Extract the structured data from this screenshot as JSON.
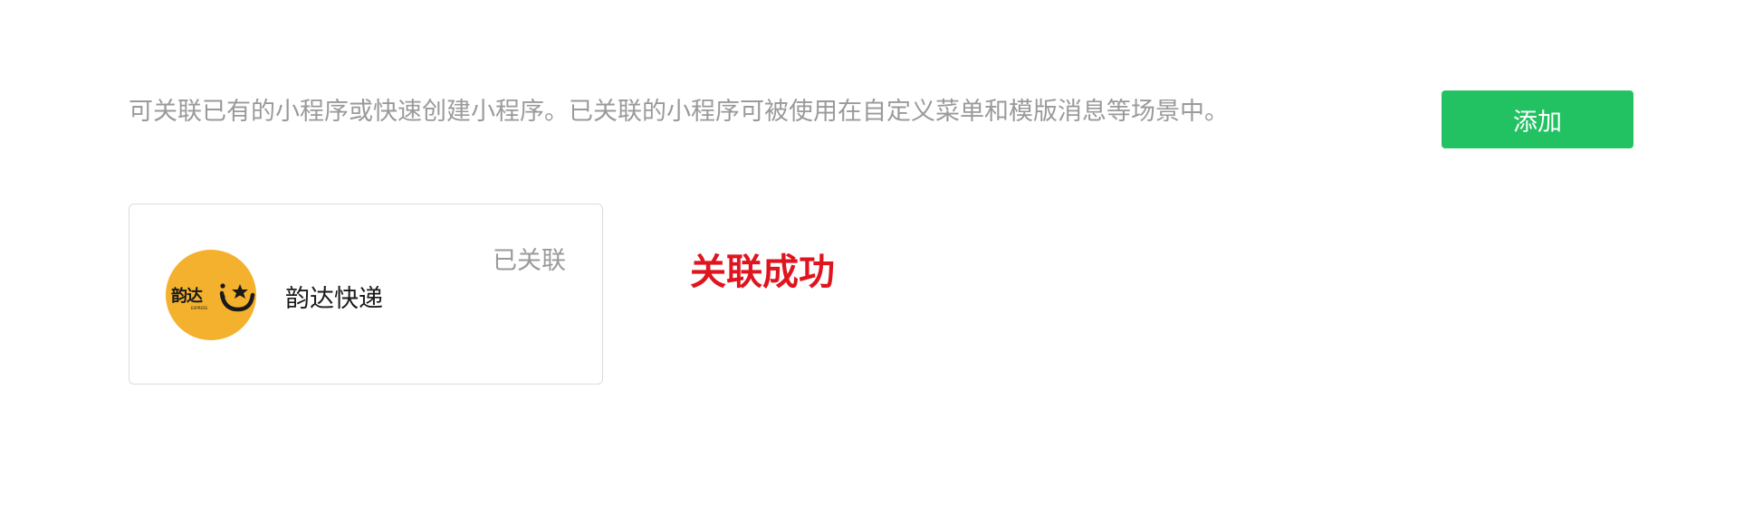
{
  "header": {
    "description": "可关联已有的小程序或快速创建小程序。已关联的小程序可被使用在自定义菜单和模版消息等场景中。",
    "add_label": "添加"
  },
  "accent_color": "#22c263",
  "linked_apps": [
    {
      "name": "韵达快递",
      "status": "已关联",
      "logo_text": "韵达",
      "logo_subtext": "EXPRESS",
      "logo_color": "#f4b12d"
    }
  ],
  "toast": {
    "message": "关联成功",
    "color": "#e0141e"
  }
}
